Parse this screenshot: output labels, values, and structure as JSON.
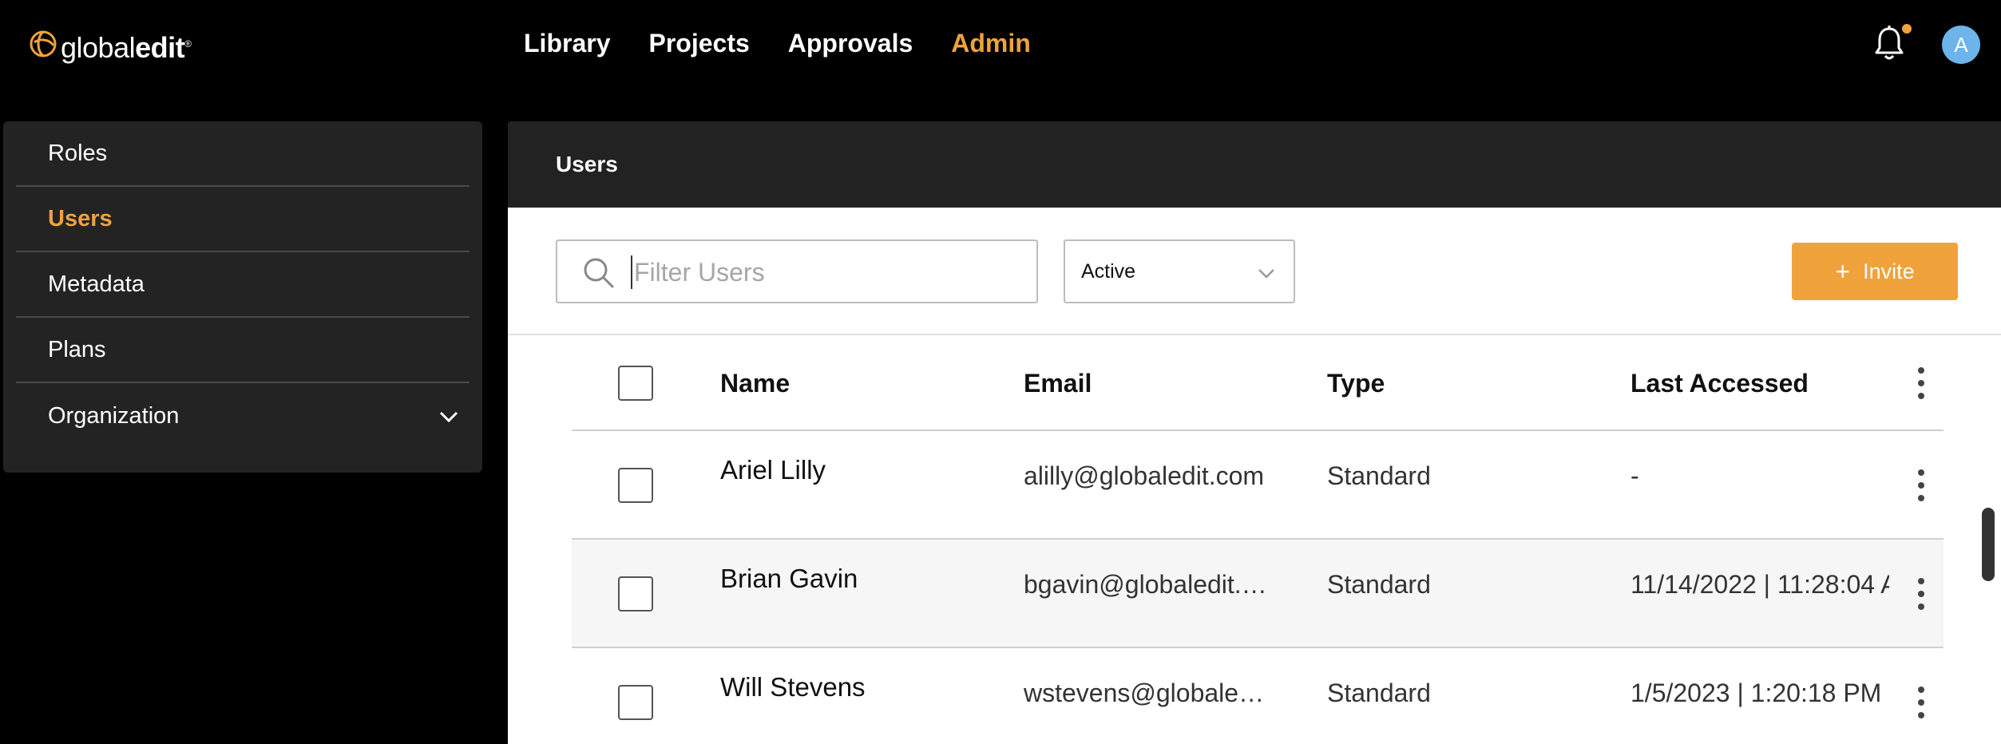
{
  "brand": {
    "logo_regular": "global",
    "logo_bold": "edit",
    "logo_mark": "®",
    "accent": "#f0a23b"
  },
  "nav": {
    "items": [
      {
        "label": "Library",
        "active": false
      },
      {
        "label": "Projects",
        "active": false
      },
      {
        "label": "Approvals",
        "active": false
      },
      {
        "label": "Admin",
        "active": true
      }
    ]
  },
  "header_right": {
    "bell_icon": "bell-icon",
    "has_notification": true,
    "avatar_initial": "A",
    "avatar_color": "#6cb4ea"
  },
  "sidebar": {
    "items": [
      {
        "label": "Roles",
        "active": false
      },
      {
        "label": "Users",
        "active": true
      },
      {
        "label": "Metadata",
        "active": false
      },
      {
        "label": "Plans",
        "active": false
      },
      {
        "label": "Organization",
        "active": false,
        "expandable": true
      }
    ]
  },
  "panel": {
    "title": "Users"
  },
  "toolbar": {
    "search_placeholder": "Filter Users",
    "status_select": "Active",
    "invite_label": "Invite",
    "invite_icon": "plus-icon"
  },
  "table": {
    "columns": {
      "name": "Name",
      "email": "Email",
      "type": "Type",
      "last": "Last Accessed"
    },
    "rows": [
      {
        "name": "Ariel Lilly",
        "email": "alilly@globaledit.com",
        "type": "Standard",
        "last": "-"
      },
      {
        "name": "Brian Gavin",
        "email": "bgavin@globaledit.…",
        "type": "Standard",
        "last": "11/14/2022 | 11:28:04 A"
      },
      {
        "name": "Will Stevens",
        "email": "wstevens@globale…",
        "type": "Standard",
        "last": "1/5/2023 | 1:20:18 PM"
      }
    ]
  }
}
